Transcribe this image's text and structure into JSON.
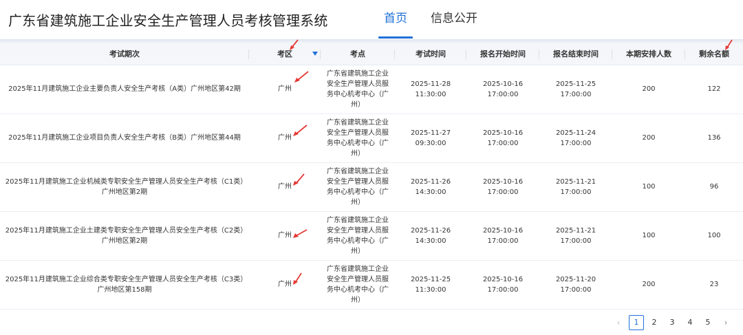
{
  "header": {
    "title": "广东省建筑施工企业安全生产管理人员考核管理系统",
    "nav": [
      {
        "label": "首页",
        "active": true
      },
      {
        "label": "信息公开",
        "active": false
      }
    ]
  },
  "table": {
    "columns": [
      "考试期次",
      "考区",
      "考点",
      "考试时间",
      "报名开始时间",
      "报名结束时间",
      "本期安排人数",
      "剩余名额"
    ],
    "rows": [
      {
        "period": "2025年11月建筑施工企业主要负责人安全生产考核（A类）广州地区第42期",
        "area": "广州",
        "site": "广东省建筑施工企业安全生产管理人员服务中心机考中心（广州）",
        "exam_time": "2025-11-28 11:30:00",
        "reg_start": "2025-10-16 17:00:00",
        "reg_end": "2025-11-25 17:00:00",
        "planned": "200",
        "remaining": "122"
      },
      {
        "period": "2025年11月建筑施工企业项目负责人安全生产考核（B类）广州地区第44期",
        "area": "广州",
        "site": "广东省建筑施工企业安全生产管理人员服务中心机考中心（广州）",
        "exam_time": "2025-11-27 09:30:00",
        "reg_start": "2025-10-16 17:00:00",
        "reg_end": "2025-11-24 17:00:00",
        "planned": "200",
        "remaining": "136"
      },
      {
        "period": "2025年11月建筑施工企业机械类专职安全生产管理人员安全生产考核（C1类）广州地区第2期",
        "area": "广州",
        "site": "广东省建筑施工企业安全生产管理人员服务中心机考中心（广州）",
        "exam_time": "2025-11-26 14:30:00",
        "reg_start": "2025-10-16 17:00:00",
        "reg_end": "2025-11-21 17:00:00",
        "planned": "100",
        "remaining": "96"
      },
      {
        "period": "2025年11月建筑施工企业土建类专职安全生产管理人员安全生产考核（C2类）广州地区第2期",
        "area": "广州",
        "site": "广东省建筑施工企业安全生产管理人员服务中心机考中心（广州）",
        "exam_time": "2025-11-26 14:30:00",
        "reg_start": "2025-10-16 17:00:00",
        "reg_end": "2025-11-21 17:00:00",
        "planned": "100",
        "remaining": "100"
      },
      {
        "period": "2025年11月建筑施工企业综合类专职安全生产管理人员安全生产考核（C3类）广州地区第158期",
        "area": "广州",
        "site": "广东省建筑施工企业安全生产管理人员服务中心机考中心（广州）",
        "exam_time": "2025-11-25 11:30:00",
        "reg_start": "2025-10-16 17:00:00",
        "reg_end": "2025-11-20 17:00:00",
        "planned": "200",
        "remaining": "23"
      }
    ]
  },
  "pagination": {
    "prev": "‹",
    "pages": [
      "1",
      "2",
      "3",
      "4",
      "5"
    ],
    "current": "1",
    "next": "›"
  },
  "colors": {
    "accent": "#1e6fd9",
    "annotation": "#e53935"
  }
}
